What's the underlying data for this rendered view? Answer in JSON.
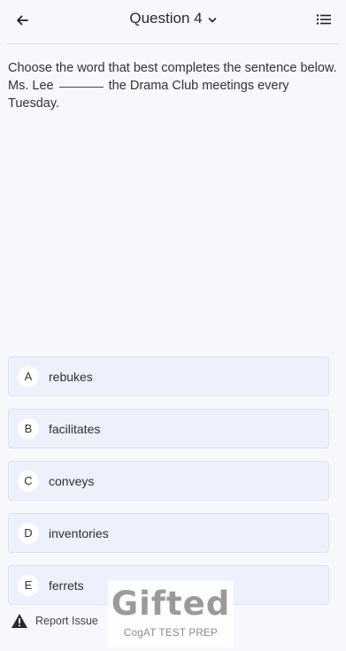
{
  "header": {
    "title": "Question 4",
    "back_icon": "arrow-left-icon",
    "dropdown_icon": "chevron-down-icon",
    "list_icon": "list-icon"
  },
  "question": {
    "instruction": "Choose the word that best completes the sentence below.",
    "sentence_before": "Ms. Lee",
    "sentence_after": "the Drama Club meetings every Tuesday."
  },
  "options": [
    {
      "letter": "A",
      "text": "rebukes"
    },
    {
      "letter": "B",
      "text": "facilitates"
    },
    {
      "letter": "C",
      "text": "conveys"
    },
    {
      "letter": "D",
      "text": "inventories"
    },
    {
      "letter": "E",
      "text": "ferrets"
    }
  ],
  "footer": {
    "report_label": "Report Issue",
    "report_icon": "warning-icon"
  },
  "watermark": {
    "title": "Gifted",
    "subtitle": "CogAT TEST PREP"
  }
}
